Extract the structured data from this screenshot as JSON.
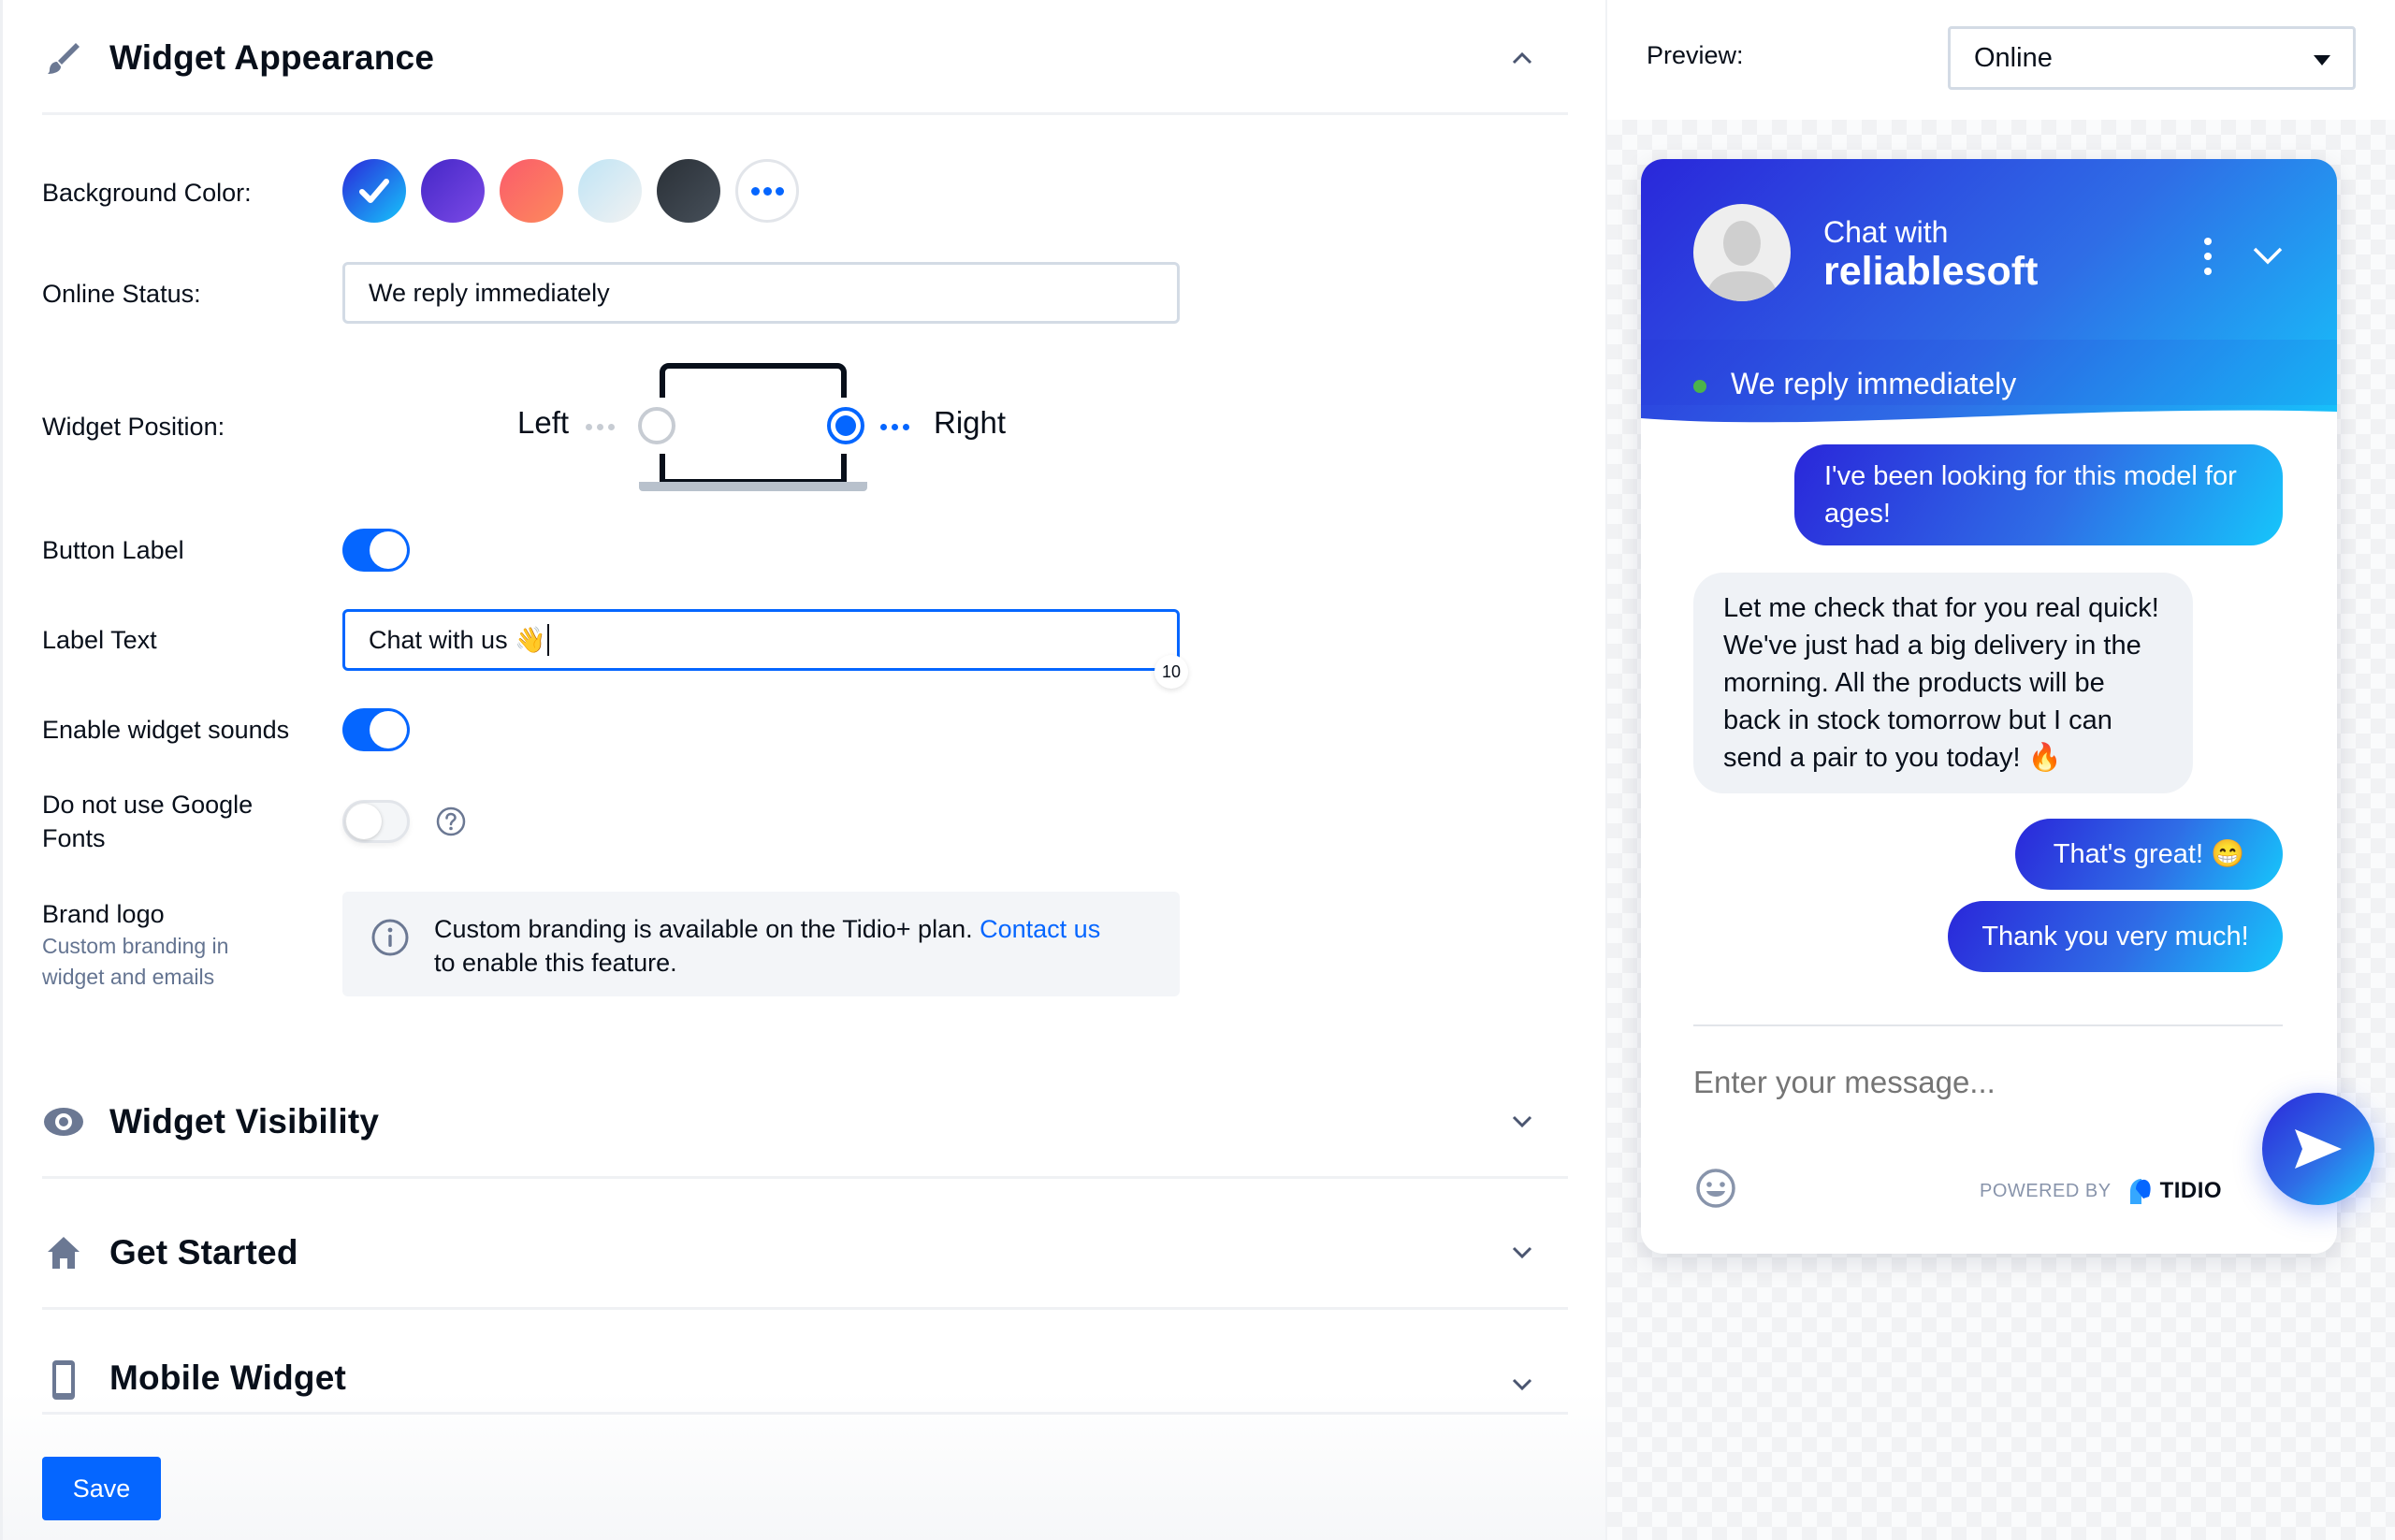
{
  "sections": {
    "appearance": {
      "title": "Widget Appearance",
      "icon": "paintbrush-icon",
      "expanded": true
    },
    "visibility": {
      "title": "Widget Visibility",
      "icon": "eye-icon",
      "expanded": false
    },
    "get_started": {
      "title": "Get Started",
      "icon": "home-icon",
      "expanded": false
    },
    "mobile": {
      "title": "Mobile Widget",
      "icon": "mobile-phone-icon",
      "expanded": false
    }
  },
  "appearance": {
    "background_color": {
      "label": "Background Color:",
      "swatches": [
        {
          "name": "blue",
          "from": "#2a27da",
          "to": "#16c6fb",
          "selected": true
        },
        {
          "name": "purple",
          "from": "#4527c7",
          "to": "#7b4ae6",
          "selected": false
        },
        {
          "name": "coral",
          "from": "#fb5b6b",
          "to": "#fc8a5c",
          "selected": false
        },
        {
          "name": "light-blue",
          "from": "#bfe4f5",
          "to": "#f2f2f2",
          "selected": false
        },
        {
          "name": "dark",
          "from": "#2a3037",
          "to": "#47505a",
          "selected": false
        }
      ],
      "more_label": "more colors"
    },
    "online_status": {
      "label": "Online Status:",
      "value": "We reply immediately"
    },
    "widget_position": {
      "label": "Widget Position:",
      "left_label": "Left",
      "right_label": "Right",
      "selected": "Right"
    },
    "button_label": {
      "label": "Button Label",
      "enabled": true
    },
    "label_text": {
      "label": "Label Text",
      "value": "Chat with us 👋",
      "remaining": "10"
    },
    "widget_sounds": {
      "label": "Enable widget sounds",
      "enabled": true
    },
    "google_fonts": {
      "label_line1": "Do not use Google",
      "label_line2": "Fonts",
      "enabled": false
    },
    "brand_logo": {
      "label": "Brand logo",
      "sublabel_line1": "Custom branding in",
      "sublabel_line2": "widget and emails",
      "info_text": "Custom branding is available on the Tidio+ plan.",
      "info_link": "Contact us",
      "info_text_2": "to enable this feature."
    }
  },
  "save_label": "Save",
  "preview": {
    "label": "Preview:",
    "selected": "Online",
    "chat": {
      "title_line1": "Chat with",
      "title_line2": "reliablesoft",
      "status": "We reply immediately",
      "messages": [
        {
          "from": "visitor",
          "text": "I've been looking for this model for ages!"
        },
        {
          "from": "operator",
          "text": "Let me check that for you real quick! We've just had a big delivery in the morning. All the products will be back in stock tomorrow but I can send a pair to you today! 🔥"
        },
        {
          "from": "visitor",
          "text": "That's great! 😁"
        },
        {
          "from": "visitor",
          "text": "Thank you very much!"
        }
      ],
      "input_placeholder": "Enter your message...",
      "powered_by": "POWERED BY",
      "brand": "TIDIO"
    }
  },
  "colors": {
    "accent": "#0566ff",
    "text": "#080f1a",
    "muted": "#647491",
    "online": "#4bb34b"
  }
}
